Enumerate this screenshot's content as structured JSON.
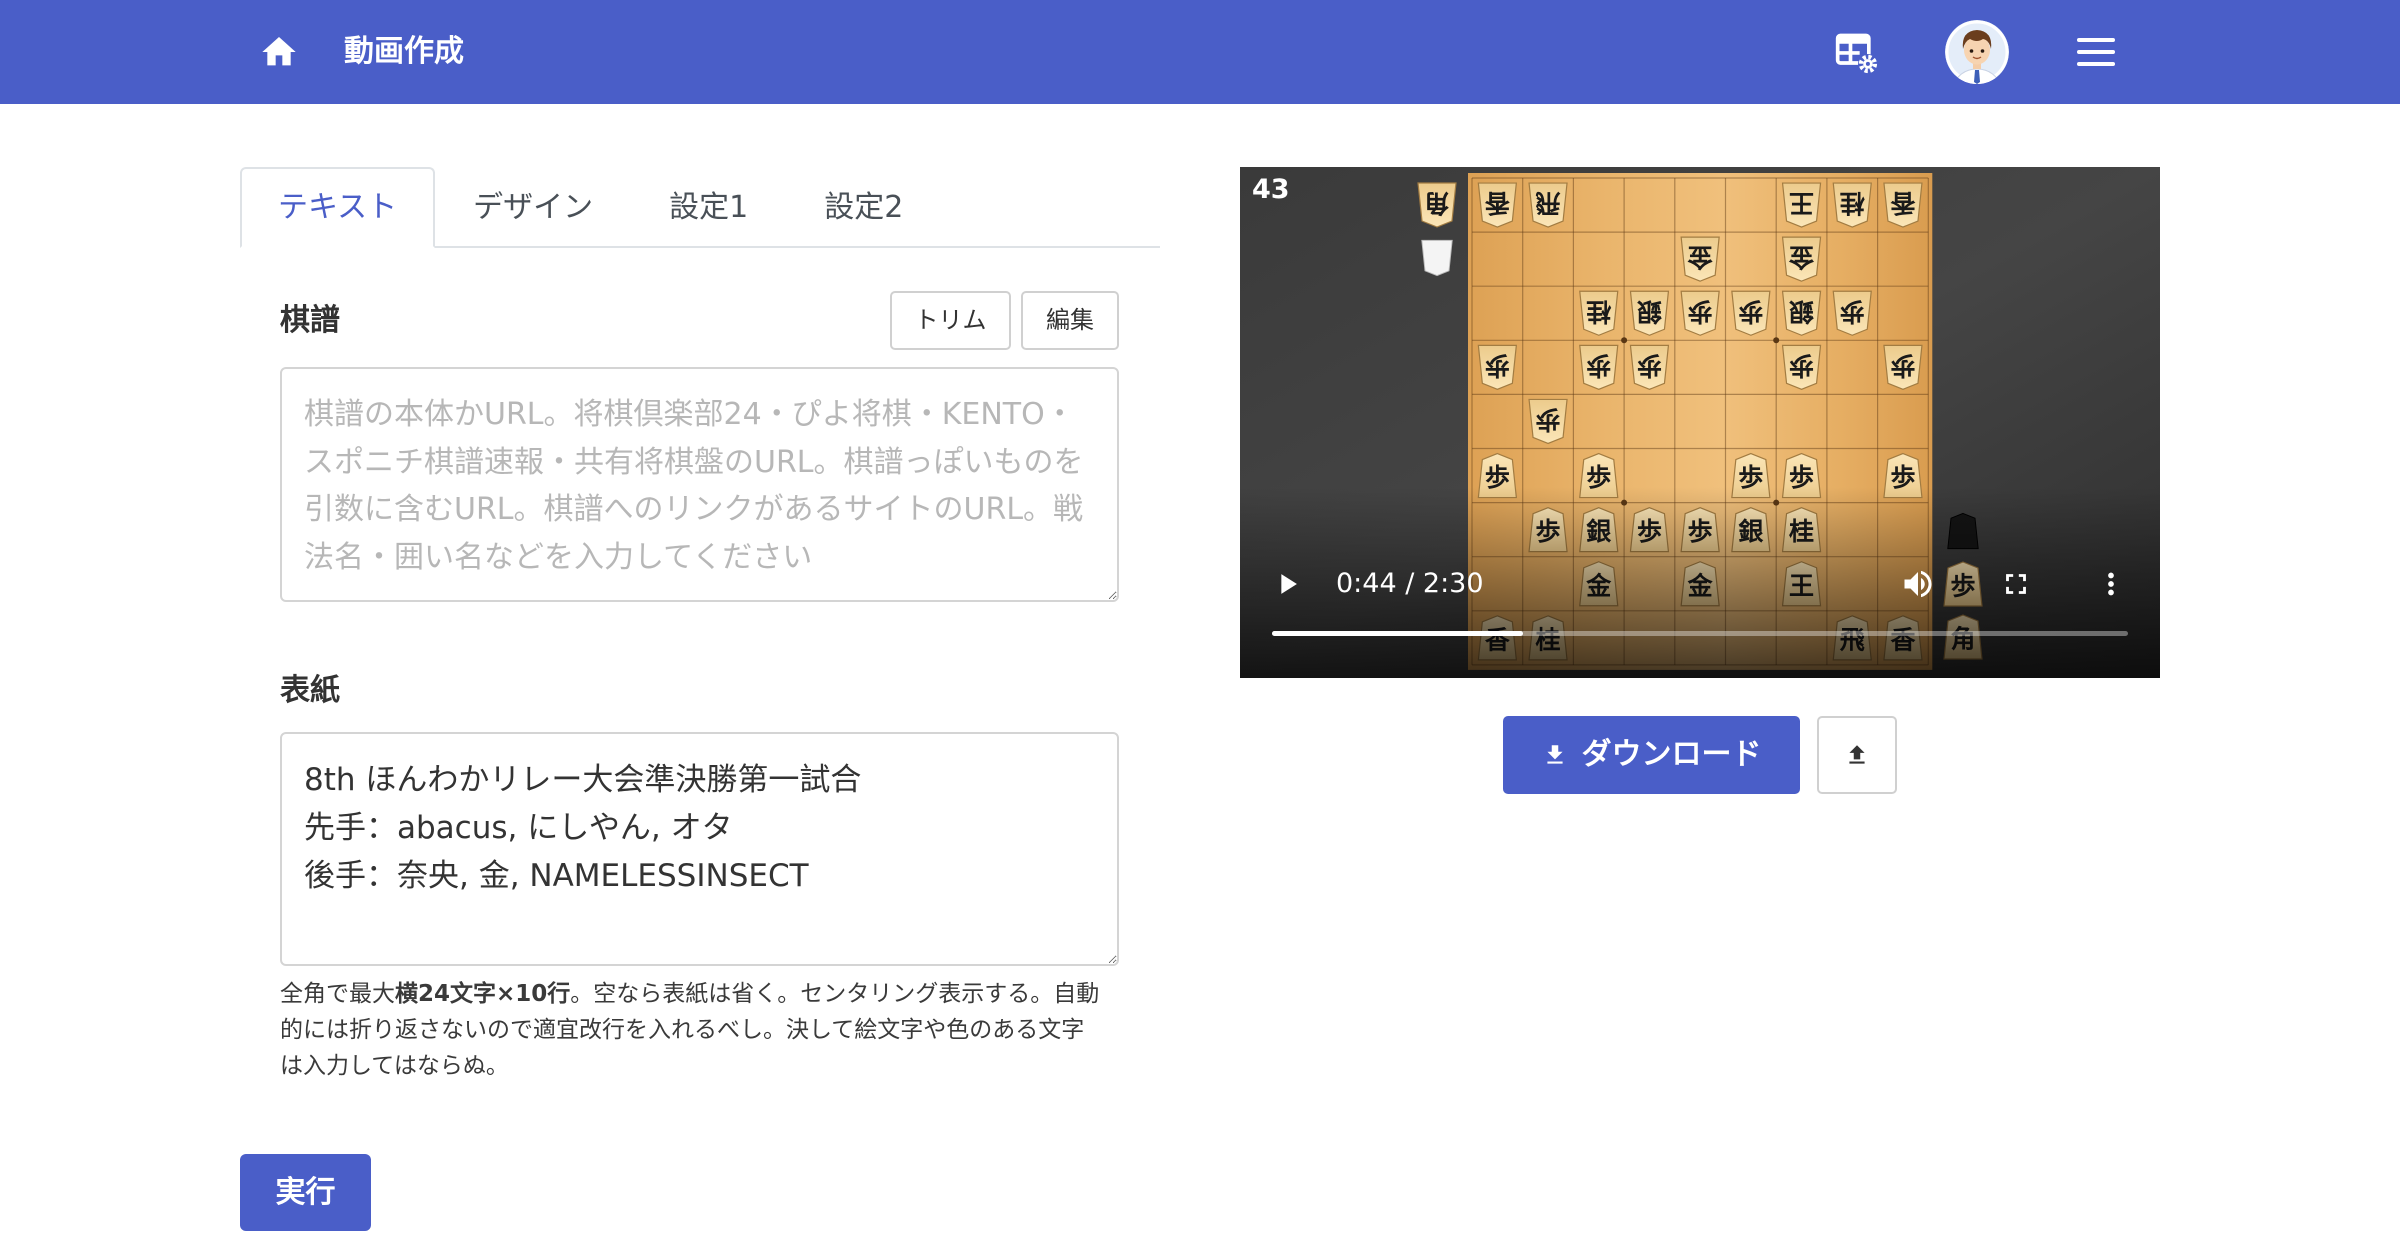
{
  "colors": {
    "accent": "#4a5ec8"
  },
  "header": {
    "title": "動画作成",
    "icons": [
      "home-icon",
      "table-settings-icon",
      "avatar",
      "hamburger-menu-icon"
    ]
  },
  "tabs": [
    {
      "label": "テキスト",
      "active": true
    },
    {
      "label": "デザイン",
      "active": false
    },
    {
      "label": "設定1",
      "active": false
    },
    {
      "label": "設定2",
      "active": false
    }
  ],
  "kifu": {
    "label": "棋譜",
    "trim_button": "トリム",
    "edit_button": "編集",
    "value": "",
    "placeholder": "棋譜の本体かURL。将棋倶楽部24・ぴよ将棋・KENTO・スポニチ棋譜速報・共有将棋盤のURL。棋譜っぽいものを引数に含むURL。棋譜へのリンクがあるサイトのURL。戦法名・囲い名などを入力してください"
  },
  "cover": {
    "label": "表紙",
    "value": "8th ほんわかリレー大会準決勝第一試合\n先手：abacus, にしやん, オタ\n後手：奈央, 金, NAMELESSINSECT",
    "help": {
      "prefix": "全角で最大",
      "bold": "横24文字×10行",
      "suffix": "。空なら表紙は省く。センタリング表示する。自動的には折り返さないので適宜改行を入れるべし。決して絵文字や色のある文字は入力してはならぬ。"
    }
  },
  "run_button": "実行",
  "video": {
    "move_number": "43",
    "time_display": "0:44 / 2:30",
    "progress_fraction": 0.293,
    "controls": [
      "play-icon",
      "volume-icon",
      "fullscreen-icon",
      "more-options-icon"
    ],
    "board": {
      "gote_hand": [
        "角"
      ],
      "sente_hand": [
        "歩",
        "角"
      ],
      "pieces": [
        {
          "file": 9,
          "rank": 1,
          "piece": "香",
          "side": "gote"
        },
        {
          "file": 8,
          "rank": 1,
          "piece": "飛",
          "side": "gote"
        },
        {
          "file": 3,
          "rank": 1,
          "piece": "王",
          "side": "gote"
        },
        {
          "file": 2,
          "rank": 1,
          "piece": "桂",
          "side": "gote"
        },
        {
          "file": 1,
          "rank": 1,
          "piece": "香",
          "side": "gote"
        },
        {
          "file": 5,
          "rank": 2,
          "piece": "金",
          "side": "gote"
        },
        {
          "file": 3,
          "rank": 2,
          "piece": "金",
          "side": "gote"
        },
        {
          "file": 7,
          "rank": 3,
          "piece": "桂",
          "side": "gote"
        },
        {
          "file": 6,
          "rank": 3,
          "piece": "銀",
          "side": "gote"
        },
        {
          "file": 5,
          "rank": 3,
          "piece": "歩",
          "side": "gote"
        },
        {
          "file": 4,
          "rank": 3,
          "piece": "歩",
          "side": "gote"
        },
        {
          "file": 3,
          "rank": 3,
          "piece": "銀",
          "side": "gote"
        },
        {
          "file": 2,
          "rank": 3,
          "piece": "歩",
          "side": "gote"
        },
        {
          "file": 9,
          "rank": 4,
          "piece": "歩",
          "side": "gote"
        },
        {
          "file": 7,
          "rank": 4,
          "piece": "歩",
          "side": "gote"
        },
        {
          "file": 6,
          "rank": 4,
          "piece": "歩",
          "side": "gote"
        },
        {
          "file": 3,
          "rank": 4,
          "piece": "歩",
          "side": "gote"
        },
        {
          "file": 1,
          "rank": 4,
          "piece": "歩",
          "side": "gote"
        },
        {
          "file": 8,
          "rank": 5,
          "piece": "歩",
          "side": "gote"
        },
        {
          "file": 9,
          "rank": 6,
          "piece": "歩",
          "side": "sente"
        },
        {
          "file": 7,
          "rank": 6,
          "piece": "歩",
          "side": "sente"
        },
        {
          "file": 4,
          "rank": 6,
          "piece": "歩",
          "side": "sente"
        },
        {
          "file": 3,
          "rank": 6,
          "piece": "歩",
          "side": "sente"
        },
        {
          "file": 1,
          "rank": 6,
          "piece": "歩",
          "side": "sente"
        },
        {
          "file": 8,
          "rank": 7,
          "piece": "歩",
          "side": "sente"
        },
        {
          "file": 7,
          "rank": 7,
          "piece": "銀",
          "side": "sente"
        },
        {
          "file": 6,
          "rank": 7,
          "piece": "歩",
          "side": "sente"
        },
        {
          "file": 5,
          "rank": 7,
          "piece": "歩",
          "side": "sente"
        },
        {
          "file": 4,
          "rank": 7,
          "piece": "銀",
          "side": "sente"
        },
        {
          "file": 3,
          "rank": 7,
          "piece": "桂",
          "side": "sente"
        },
        {
          "file": 7,
          "rank": 8,
          "piece": "金",
          "side": "sente"
        },
        {
          "file": 5,
          "rank": 8,
          "piece": "金",
          "side": "sente"
        },
        {
          "file": 3,
          "rank": 8,
          "piece": "王",
          "side": "sente"
        },
        {
          "file": 9,
          "rank": 9,
          "piece": "香",
          "side": "sente"
        },
        {
          "file": 8,
          "rank": 9,
          "piece": "桂",
          "side": "sente"
        },
        {
          "file": 2,
          "rank": 9,
          "piece": "飛",
          "side": "sente"
        },
        {
          "file": 1,
          "rank": 9,
          "piece": "香",
          "side": "sente"
        }
      ]
    }
  },
  "actions": {
    "download_button": "ダウンロード",
    "download_icon": "download-icon",
    "upload_icon": "upload-icon"
  }
}
